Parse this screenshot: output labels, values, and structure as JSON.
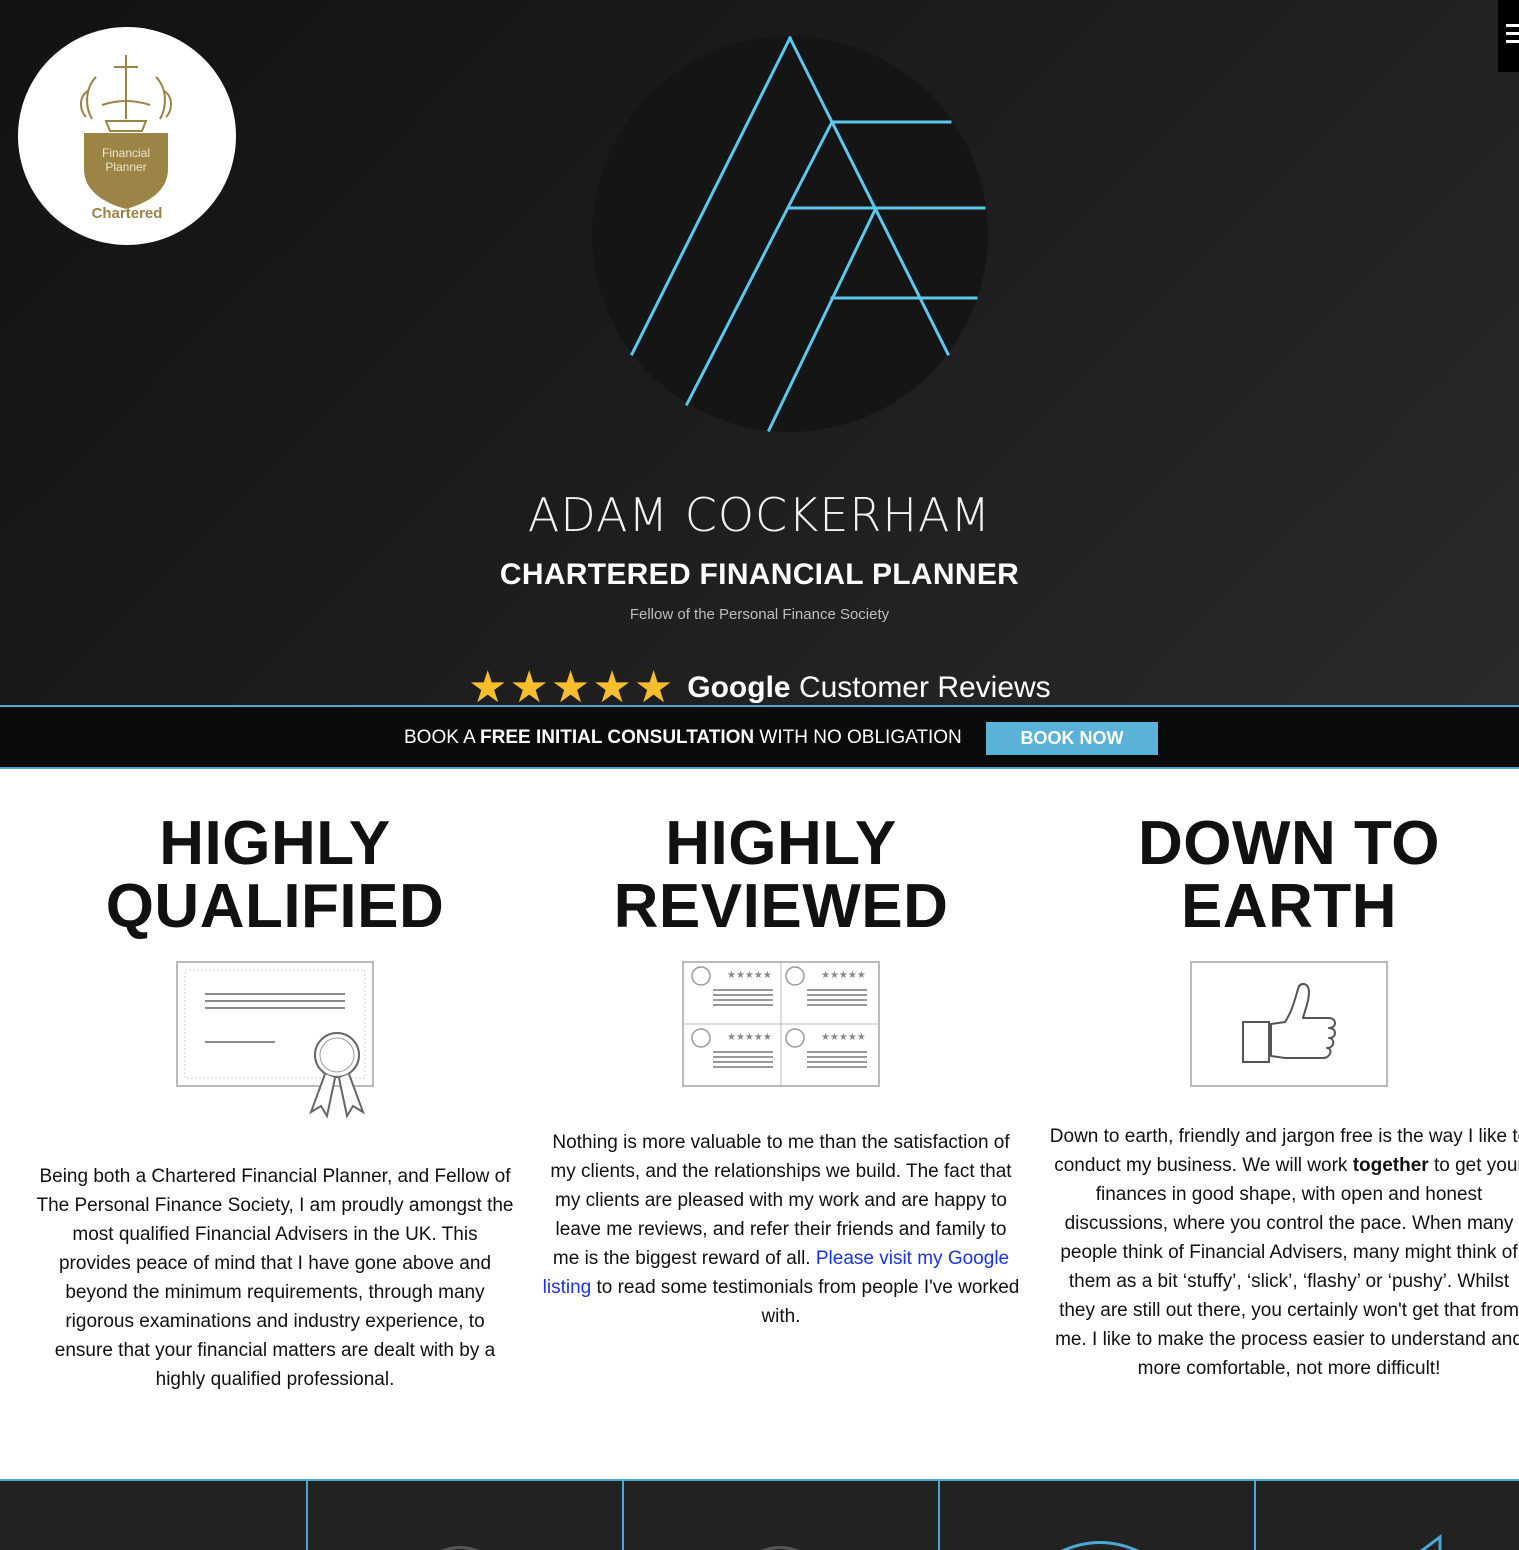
{
  "hero": {
    "badge": {
      "line1": "Financial",
      "line2": "Planner",
      "caption": "Chartered"
    },
    "name": "ADAM COCKERHAM",
    "title": "CHARTERED FINANCIAL PLANNER",
    "subtitle": "Fellow of the Personal Finance Society",
    "reviews": {
      "stars": 5,
      "brand": "Google",
      "label": " Customer Reviews"
    }
  },
  "consult": {
    "prefix": "BOOK A ",
    "bold": "FREE INITIAL CONSULTATION",
    "suffix": " WITH NO OBLIGATION",
    "button": "BOOK NOW"
  },
  "features": [
    {
      "heading_line1": "HIGHLY",
      "heading_line2": "QUALIFIED",
      "icon": "certificate-icon",
      "text": "Being both a Chartered Financial Planner, and Fellow of The Personal Finance Society, I am proudly amongst the most qualified Financial Advisers in the UK. This provides peace of mind that I have gone above and beyond the minimum requirements, through many rigorous examinations and industry experience, to ensure that your financial matters are dealt with by a highly qualified professional."
    },
    {
      "heading_line1": "HIGHLY",
      "heading_line2": "REVIEWED",
      "icon": "reviews-grid-icon",
      "text_before": "Nothing is more valuable to me than the satisfaction of my clients, and the relationships we build. The fact that my clients are pleased with my work and are happy to leave me reviews, and refer their friends and family to me is the biggest reward of all. ",
      "link": "Please visit my Google listing",
      "text_after": " to read some testimonials from people I've worked with."
    },
    {
      "heading_line1": "DOWN TO",
      "heading_line2": "EARTH",
      "icon": "thumbs-up-icon",
      "text_before": "Down to earth, friendly and jargon free is the way I like to conduct my business. We will work ",
      "bold": "together",
      "text_after": " to get your finances in good shape, with open and honest discussions, where you control the pace. When many people think of Financial Advisers, many might think of them as a bit ‘stuffy’, ‘slick’, ‘flashy’ or ‘pushy’. Whilst they are still out there, you certainly won't get that from me. I like to make the process easier to understand and more comfortable, not more difficult!"
    }
  ],
  "colors": {
    "accent": "#4ea7d3",
    "button": "#5ab2d8",
    "star": "#f6be2c",
    "badge_gold": "#9b8446",
    "link": "#1a33e6"
  }
}
